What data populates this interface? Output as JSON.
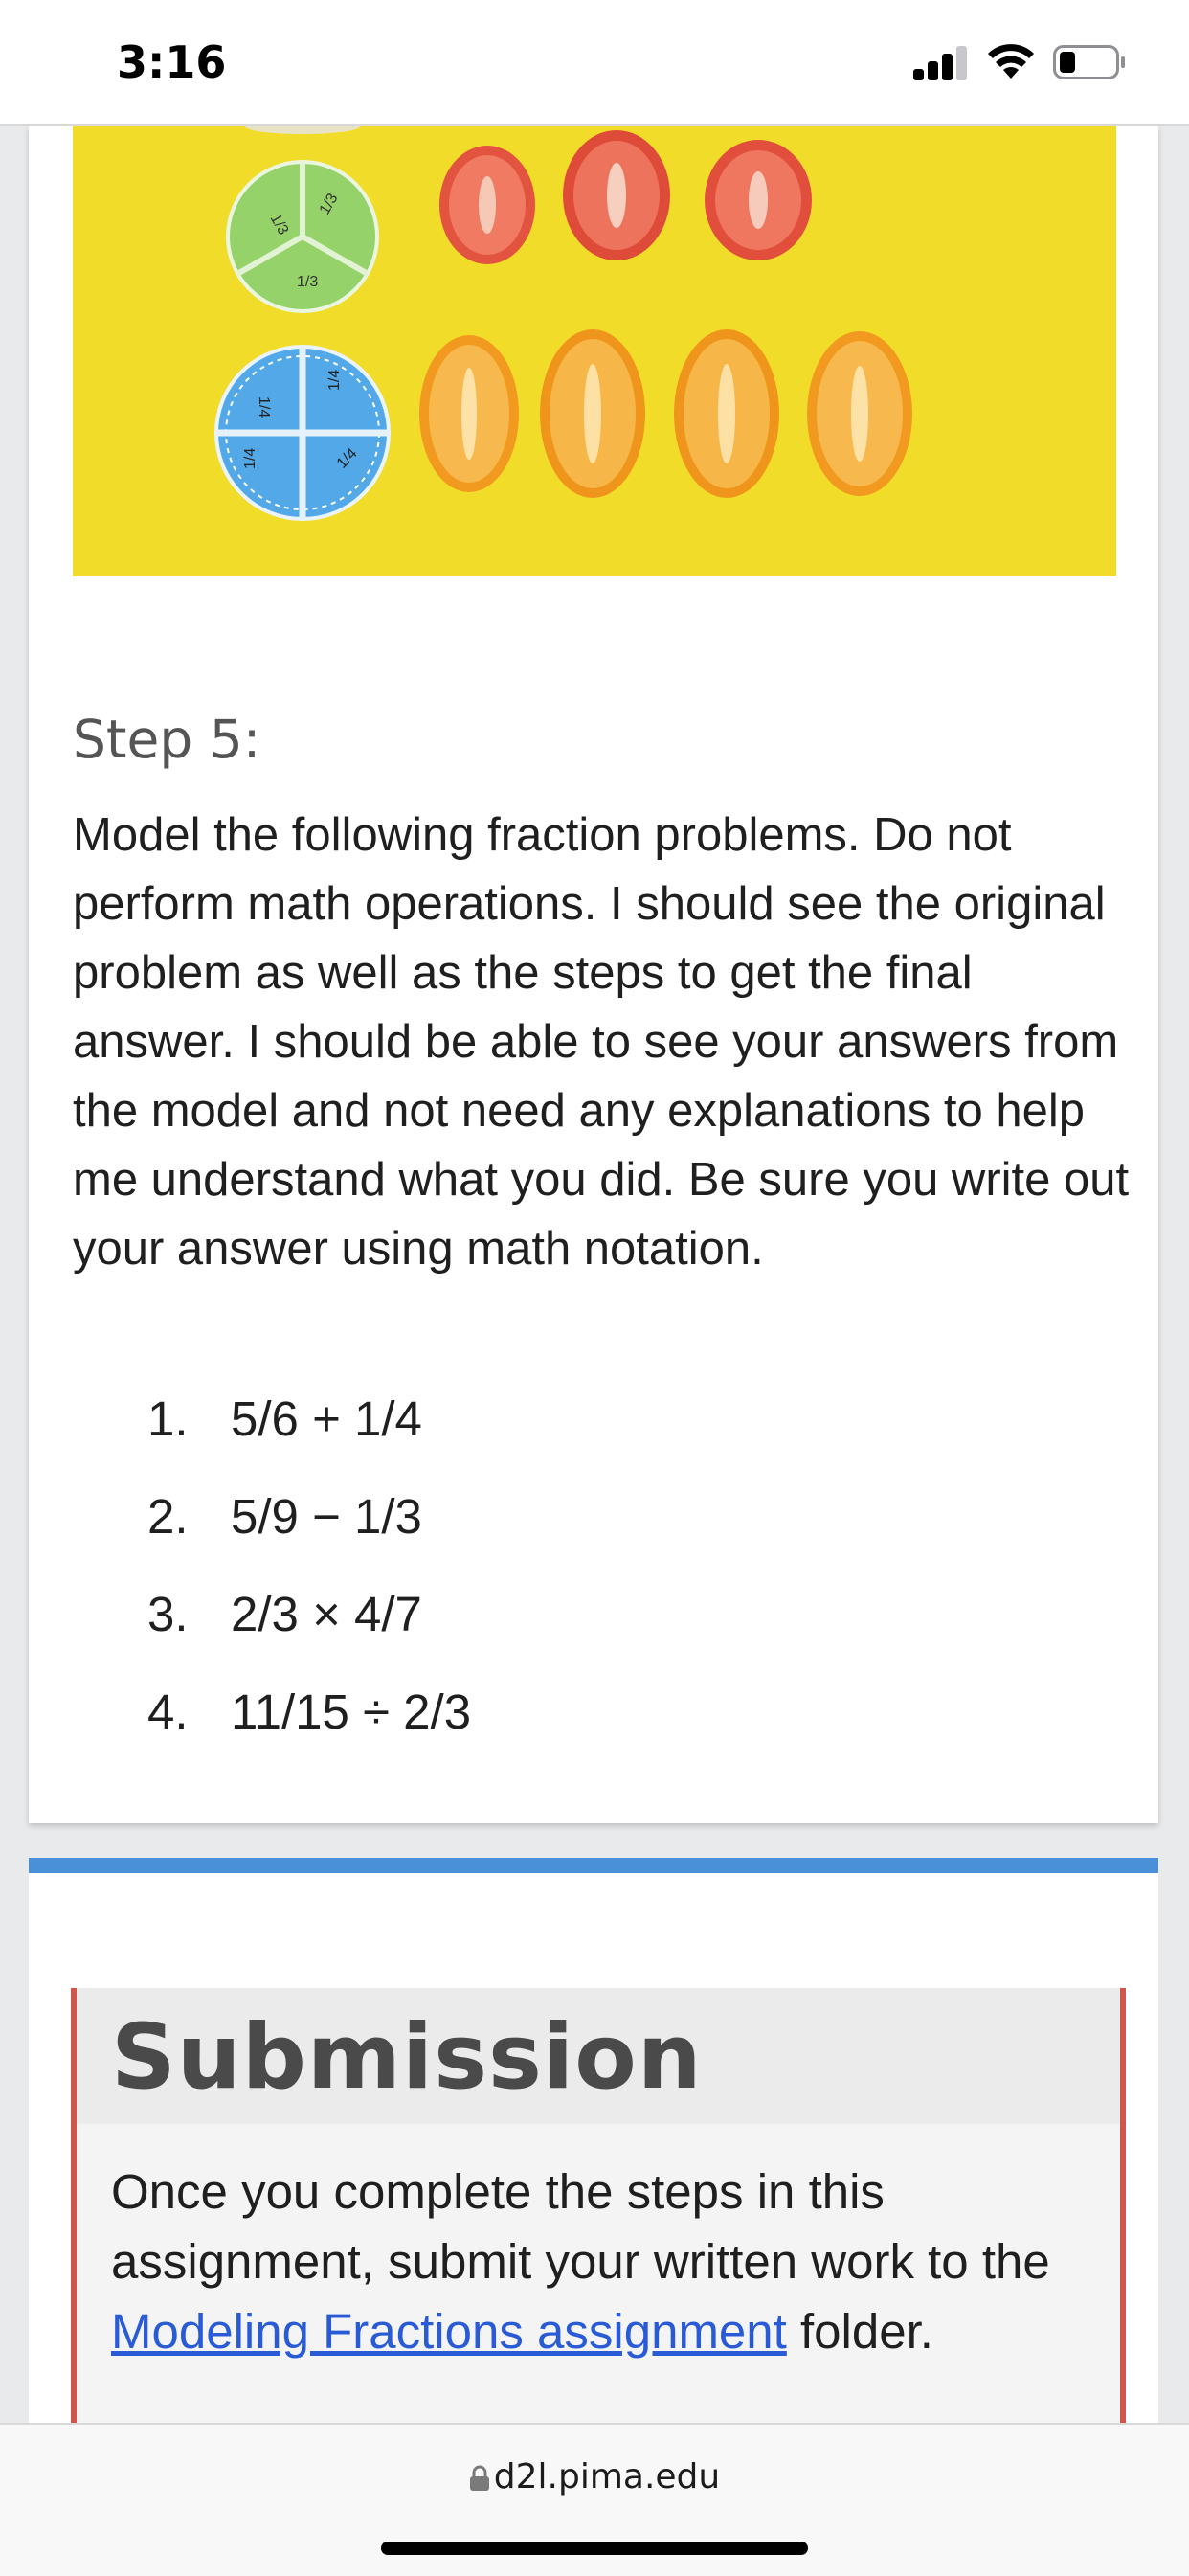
{
  "status_bar": {
    "time": "3:16",
    "signal_icon": "cellular-signal-icon",
    "wifi_icon": "wifi-icon",
    "battery_icon": "battery-icon",
    "battery_level": 0.25
  },
  "hero_image": {
    "fraction_labels_green": [
      "1/3",
      "1/3",
      "1/3"
    ],
    "fraction_labels_blue": [
      "1/4",
      "1/4",
      "1/4",
      "1/4"
    ]
  },
  "content": {
    "step_heading": "Step 5:",
    "step_body": "Model the following fraction problems. Do not perform math operations. I should see the original problem as well as the steps to get the final answer. I should be able to see your answers from the model and not need any explanations to help me understand what you did. Be sure you write out your answer using math notation.",
    "problems": [
      {
        "num": "1.",
        "text": "5/6 + 1/4"
      },
      {
        "num": "2.",
        "text": "5/9 − 1/3"
      },
      {
        "num": "3.",
        "text": "2/3 × 4/7"
      },
      {
        "num": "4.",
        "text": "11/15 ÷ 2/3"
      }
    ]
  },
  "submission": {
    "title": "Submission",
    "text_before": "Once you complete the steps in this assignment, submit your written work to the ",
    "link_text": "Modeling Fractions assignment",
    "text_after": " folder."
  },
  "browser": {
    "lock_icon": "lock-icon",
    "url": "d2l.pima.edu"
  },
  "colors": {
    "accent_blue": "#4a90d9",
    "submission_border": "#d0554c",
    "link": "#2a5bd7",
    "hero_background": "#f2dc2a"
  }
}
